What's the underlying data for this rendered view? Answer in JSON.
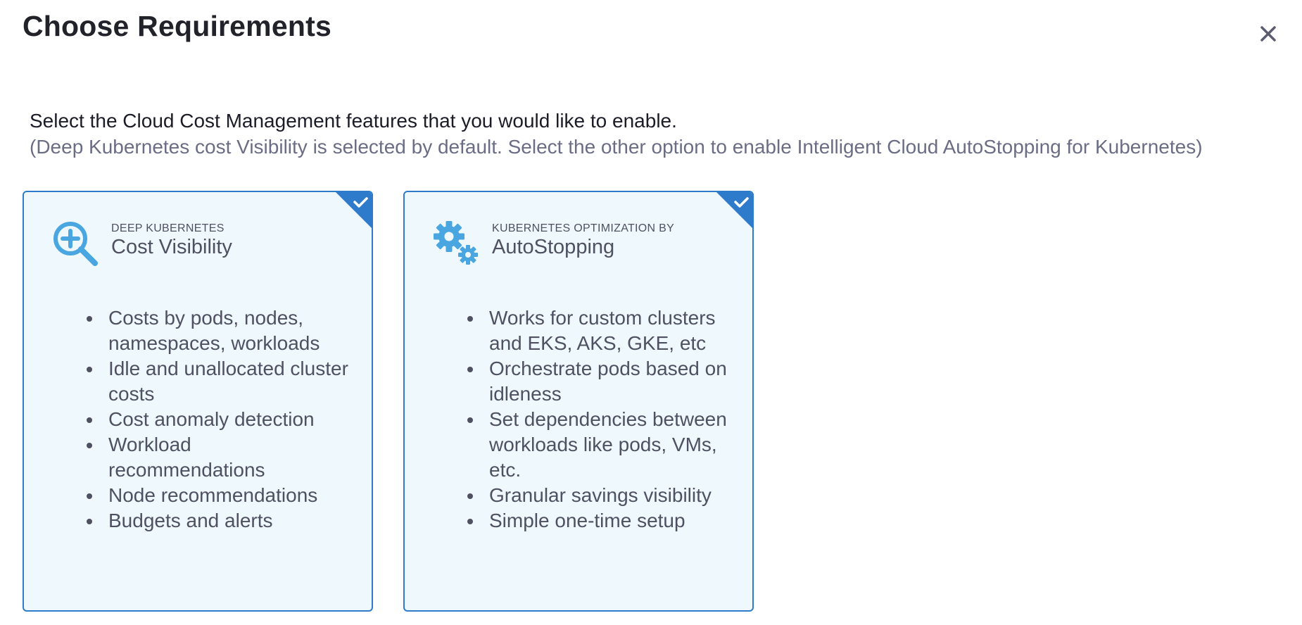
{
  "dialog": {
    "title": "Choose Requirements",
    "close_icon": "close-icon"
  },
  "intro": {
    "text": "Select the Cloud Cost Management features that you would like to enable.",
    "subtext": "(Deep Kubernetes cost Visibility is selected by default. Select the other option to enable Intelligent Cloud AutoStopping for Kubernetes)"
  },
  "cards": [
    {
      "icon": "magnifier-plus-icon",
      "kicker": "DEEP KUBERNETES",
      "title": "Cost Visibility",
      "selected": true,
      "features": [
        "Costs by pods, nodes, namespaces, workloads",
        "Idle and unallocated cluster costs",
        "Cost anomaly detection",
        "Workload recommendations",
        "Node recommendations",
        "Budgets and alerts"
      ]
    },
    {
      "icon": "gears-icon",
      "kicker": "KUBERNETES OPTIMIZATION BY",
      "title": "AutoStopping",
      "selected": true,
      "features": [
        "Works for custom clusters and EKS, AKS, GKE, etc",
        "Orchestrate pods based on idleness",
        "Set dependencies between workloads like pods, VMs, etc.",
        "Granular savings visibility",
        "Simple one-time setup"
      ]
    }
  ],
  "colors": {
    "accent": "#2f7bcb",
    "card_bg": "#eff8fc",
    "icon_blue": "#4aa6e0"
  }
}
